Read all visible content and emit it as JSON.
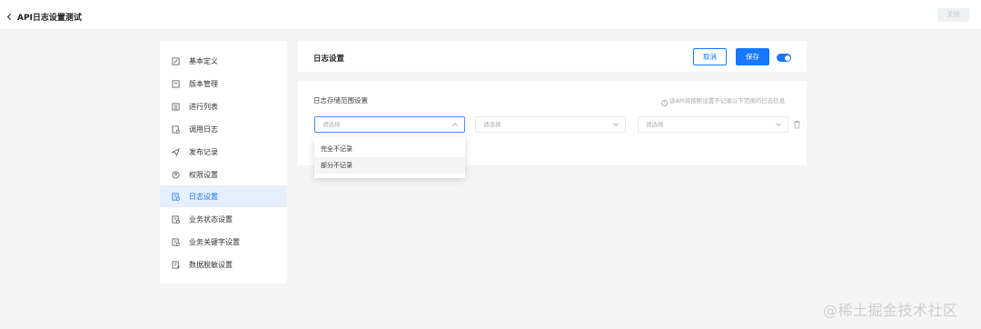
{
  "topbar": {
    "back_label": "API日志设置测试",
    "close_label": "关闭"
  },
  "sidebar": {
    "items": [
      {
        "label": "基本定义",
        "icon": "edit-doc-icon"
      },
      {
        "label": "版本管理",
        "icon": "version-icon"
      },
      {
        "label": "进行列表",
        "icon": "list-icon"
      },
      {
        "label": "调用日志",
        "icon": "log-icon"
      },
      {
        "label": "发布记录",
        "icon": "send-icon"
      },
      {
        "label": "权限设置",
        "icon": "permission-icon"
      },
      {
        "label": "日志设置",
        "icon": "log-settings-icon",
        "active": true
      },
      {
        "label": "业务状态设置",
        "icon": "status-settings-icon"
      },
      {
        "label": "业务关键字设置",
        "icon": "keyword-settings-icon"
      },
      {
        "label": "数据脱敏设置",
        "icon": "desensitize-icon"
      }
    ]
  },
  "header": {
    "title": "日志设置",
    "cancel_label": "取消",
    "save_label": "保存",
    "toggle_on": true
  },
  "body": {
    "section_label": "日志存储范围设置",
    "hint": "该API将按照设置不记录以下范围的日志信息",
    "selects": [
      {
        "placeholder": "请选择"
      },
      {
        "placeholder": "请选择"
      },
      {
        "placeholder": "请选择"
      }
    ]
  },
  "dropdown": {
    "options": [
      "完全不记录",
      "部分不记录"
    ]
  },
  "watermark": "@稀土掘金技术社区",
  "colors": {
    "accent": "#1677ff",
    "active_bg": "#e6f0fd",
    "page_bg": "#f5f5f5"
  }
}
